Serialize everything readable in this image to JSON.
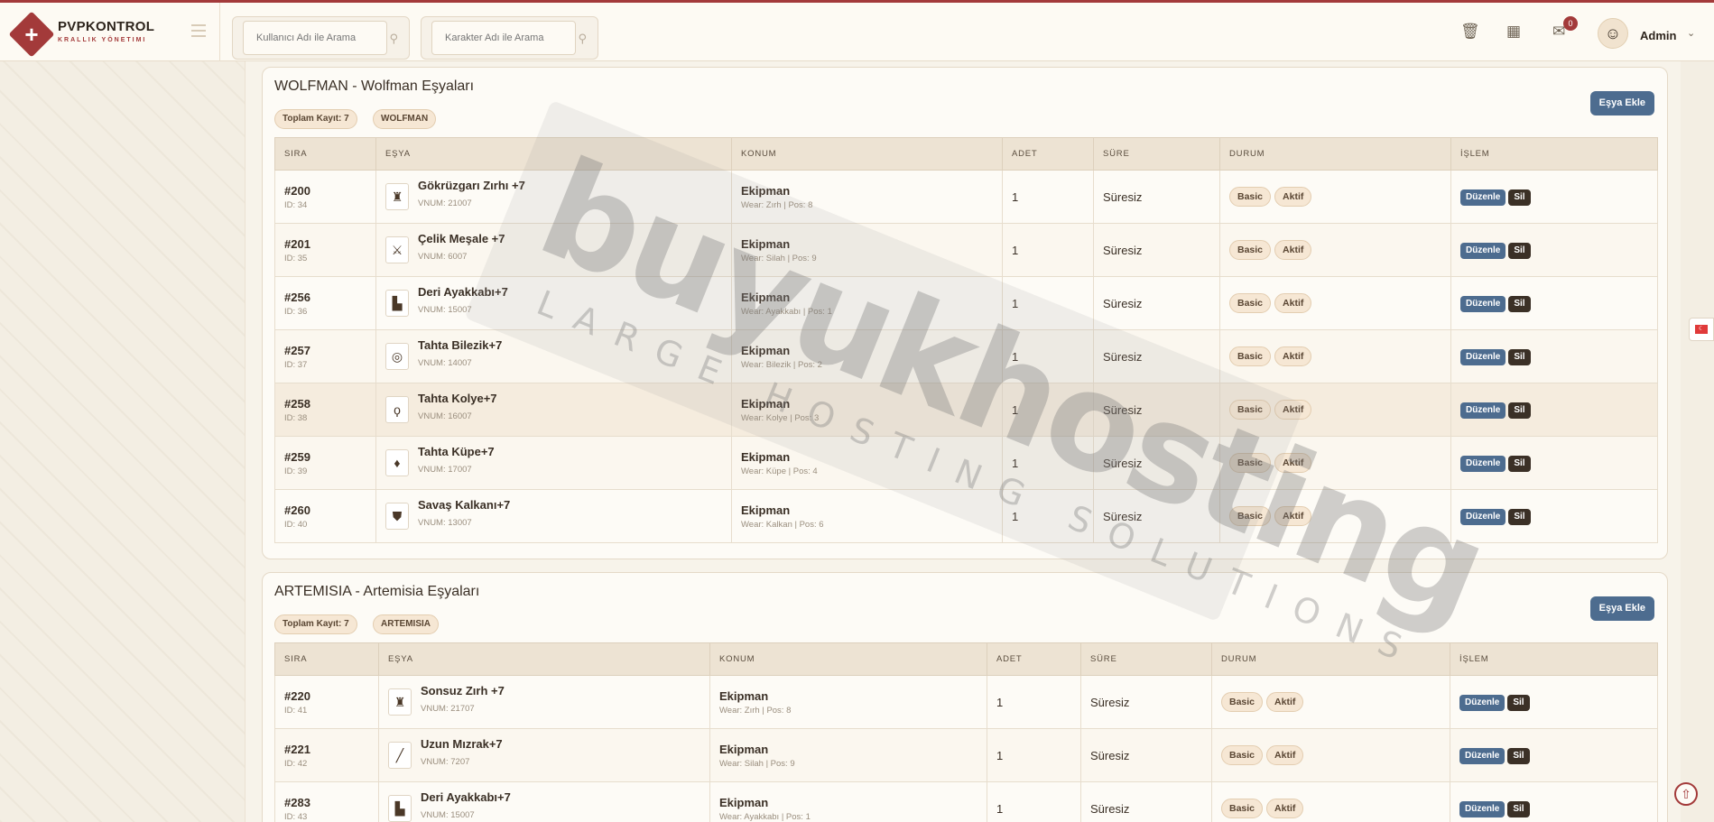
{
  "header": {
    "brand_name": "PVPKONTROL",
    "brand_sub": "KRALLIK YÖNETIMI",
    "search_user_placeholder": "Kullanıcı Adı ile Arama",
    "search_char_placeholder": "Karakter Adı ile Arama",
    "message_count": "0",
    "admin_name": "Admin",
    "icons": [
      "trash-icon",
      "calendar-icon",
      "mail-icon"
    ]
  },
  "colors": {
    "accent": "#a33a3a",
    "button_blue": "#4d6c8f",
    "button_dark": "#3b3026",
    "tag_bg": "#f6e7d4"
  },
  "columns": [
    "SIRA",
    "EŞYA",
    "KONUM",
    "ADET",
    "SÜRE",
    "DURUM",
    "İŞLEM"
  ],
  "labels": {
    "add_item": "Eşya Ekle",
    "edit": "Düzenle",
    "delete": "Sil",
    "basic": "Basic",
    "active": "Aktif"
  },
  "wolfman": {
    "title": "WOLFMAN - Wolfman Eşyaları",
    "total": "Toplam Kayıt: 7",
    "tag": "WOLFMAN",
    "rows": [
      {
        "sira": "#200",
        "id": "ID: 34",
        "item": "Gökrüzgarı Zırhı +7",
        "vnum": "VNUM: 21007",
        "konum": "Ekipman",
        "wear": "Wear: Zırh | Pos: 8",
        "adet": "1",
        "sure": "Süresiz"
      },
      {
        "sira": "#201",
        "id": "ID: 35",
        "item": "Çelik Meşale +7",
        "vnum": "VNUM: 6007",
        "konum": "Ekipman",
        "wear": "Wear: Silah | Pos: 9",
        "adet": "1",
        "sure": "Süresiz"
      },
      {
        "sira": "#256",
        "id": "ID: 36",
        "item": "Deri Ayakkabı+7",
        "vnum": "VNUM: 15007",
        "konum": "Ekipman",
        "wear": "Wear: Ayakkabı | Pos: 1",
        "adet": "1",
        "sure": "Süresiz"
      },
      {
        "sira": "#257",
        "id": "ID: 37",
        "item": "Tahta Bilezik+7",
        "vnum": "VNUM: 14007",
        "konum": "Ekipman",
        "wear": "Wear: Bilezik | Pos: 2",
        "adet": "1",
        "sure": "Süresiz"
      },
      {
        "sira": "#258",
        "id": "ID: 38",
        "item": "Tahta Kolye+7",
        "vnum": "VNUM: 16007",
        "konum": "Ekipman",
        "wear": "Wear: Kolye | Pos: 3",
        "adet": "1",
        "sure": "Süresiz"
      },
      {
        "sira": "#259",
        "id": "ID: 39",
        "item": "Tahta Küpe+7",
        "vnum": "VNUM: 17007",
        "konum": "Ekipman",
        "wear": "Wear: Küpe | Pos: 4",
        "adet": "1",
        "sure": "Süresiz"
      },
      {
        "sira": "#260",
        "id": "ID: 40",
        "item": "Savaş Kalkanı+7",
        "vnum": "VNUM: 13007",
        "konum": "Ekipman",
        "wear": "Wear: Kalkan | Pos: 6",
        "adet": "1",
        "sure": "Süresiz"
      }
    ]
  },
  "artemisia": {
    "title": "ARTEMISIA - Artemisia Eşyaları",
    "total": "Toplam Kayıt: 7",
    "tag": "ARTEMISIA",
    "rows": [
      {
        "sira": "#220",
        "id": "ID: 41",
        "item": "Sonsuz Zırh +7",
        "vnum": "VNUM: 21707",
        "konum": "Ekipman",
        "wear": "Wear: Zırh | Pos: 8",
        "adet": "1",
        "sure": "Süresiz"
      },
      {
        "sira": "#221",
        "id": "ID: 42",
        "item": "Uzun Mızrak+7",
        "vnum": "VNUM: 7207",
        "konum": "Ekipman",
        "wear": "Wear: Silah | Pos: 9",
        "adet": "1",
        "sure": "Süresiz"
      },
      {
        "sira": "#283",
        "id": "ID: 43",
        "item": "Deri Ayakkabı+7",
        "vnum": "VNUM: 15007",
        "konum": "Ekipman",
        "wear": "Wear: Ayakkabı | Pos: 1",
        "adet": "1",
        "sure": "Süresiz"
      }
    ]
  },
  "watermark": {
    "main": "buyukhosting",
    "sub": "LARGE HOSTING SOLUTIONS"
  }
}
